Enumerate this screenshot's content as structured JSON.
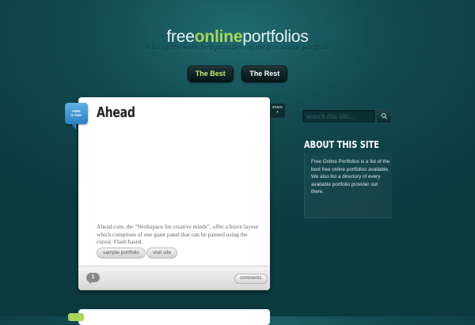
{
  "header": {
    "logo_part1": "free",
    "logo_part2": "online",
    "logo_part3": "portfolios",
    "tagline": "A list of the webs best providers of the free online portfolio"
  },
  "nav": {
    "items": [
      {
        "label": "The Best",
        "active": true
      },
      {
        "label": "The Rest",
        "active": false
      }
    ]
  },
  "post": {
    "badge_line1": "FREE",
    "badge_line2": "& PAID",
    "title": "Ahead",
    "description": "Ahead.com, the \"Workspace for creative minds\", offer a brave layout which comprises of one giant panel that can be panned using the cursor. Flash based.",
    "tag_sample": "sample portfolio",
    "tag_visit": "visit site",
    "comment_count": "1",
    "comments_label": "comments",
    "share_line1": "share",
    "share_line2": "+"
  },
  "sidebar": {
    "search_placeholder": "search this site...",
    "about_title": "ABOUT THIS SITE",
    "about_text": "Free Online Portfolios is a list of the best free online portfolios available. We also list a directory of every available portfolio provider out there."
  },
  "colors": {
    "accent_green": "#a8d65a",
    "badge_blue": "#2e82c4",
    "background": "#0b3a3f"
  }
}
